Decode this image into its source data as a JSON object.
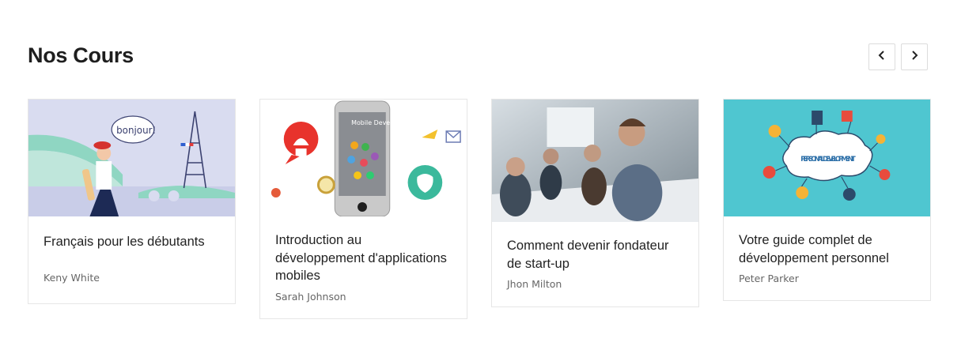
{
  "section": {
    "title": "Nos Cours"
  },
  "nav": {
    "prev_icon": "chevron-left-icon",
    "next_icon": "chevron-right-icon"
  },
  "courses": [
    {
      "title": "Français pour les débutants",
      "author": "Keny White",
      "image": "paris-illustration",
      "image_text": "bonjour!"
    },
    {
      "title": "Introduction au développement d'applications mobiles",
      "author": "Sarah Johnson",
      "image": "mobile-development-illustration",
      "image_text": "Mobile Development"
    },
    {
      "title": "Comment devenir fondateur de start-up",
      "author": "Jhon Milton",
      "image": "business-meeting-photo"
    },
    {
      "title": "Votre guide complet de développement personnel",
      "author": "Peter Parker",
      "image": "personal-development-illustration",
      "image_text": "PERSONAL DEVELOPMENT"
    }
  ],
  "colors": {
    "accent_teal": "#4fc6d0",
    "text_dark": "#1e1e1e",
    "text_muted": "#666666",
    "border": "#e6e6e6"
  }
}
